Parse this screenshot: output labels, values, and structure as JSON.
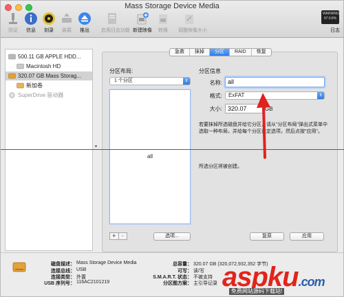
{
  "window": {
    "title": "Mass Storage Device Media"
  },
  "toolbar": {
    "verify": "验证",
    "info": "信息",
    "burn": "刻录",
    "mount": "装载",
    "eject": "推出",
    "enable_journal": "启用日志功能",
    "new_image": "新建映像",
    "convert": "转换",
    "resize_image": "调整映像大小",
    "log": "日志",
    "log_display": "WARNING\n97:0:8%"
  },
  "sidebar": {
    "items": [
      {
        "label": "500.11 GB APPLE HDD..."
      },
      {
        "label": "Macintosh HD"
      },
      {
        "label": "320.07 GB Mass Storag..."
      },
      {
        "label": "新加卷"
      },
      {
        "label": "SuperDrive 驱动器"
      }
    ]
  },
  "tabs": [
    {
      "label": "急救"
    },
    {
      "label": "抹掉"
    },
    {
      "label": "分区"
    },
    {
      "label": "RAID"
    },
    {
      "label": "恢复"
    }
  ],
  "partition": {
    "layout_title": "分区布局:",
    "layout_value": "1 个分区",
    "partition_label": "all",
    "options_button": "选项...",
    "info_title": "分区信息",
    "name_label": "名称:",
    "name_value": "all",
    "format_label": "格式:",
    "format_value": "ExFAT",
    "size_label": "大小:",
    "size_value": "320.07",
    "size_unit": "GB",
    "help_text": "若要抹掉所选磁盘并给它分区，请从\"分区布局\"弹出式菜单中选取一种布局，并给每个分区设定选项，然后点按\"应用\"。",
    "status_text": "所选分区将被创建。",
    "revert_button": "复原",
    "apply_button": "应用"
  },
  "info": {
    "disk_desc_key": "磁盘描述：",
    "disk_desc_val": "Mass Storage Device Media",
    "bus_key": "连接总线：",
    "bus_val": "USB",
    "conn_type_key": "连接类型：",
    "conn_type_val": "外置",
    "serial_key": "USB 序列号：",
    "serial_val": "116AC2101219",
    "capacity_key": "总容量：",
    "capacity_val": "320.07 GB (320,072,932,352 字节)",
    "writable_key": "可写：",
    "writable_val": "读/写",
    "smart_key": "S.M.A.R.T. 状态：",
    "smart_val": "不被支持",
    "scheme_key": "分区图方案：",
    "scheme_val": "主引导记录"
  },
  "watermark": {
    "brand": "aspku",
    "tld": ".com",
    "sub": "免费网站源码下载站!"
  },
  "colors": {
    "accent": "#2d7be8",
    "annotation": "#e0221f"
  }
}
